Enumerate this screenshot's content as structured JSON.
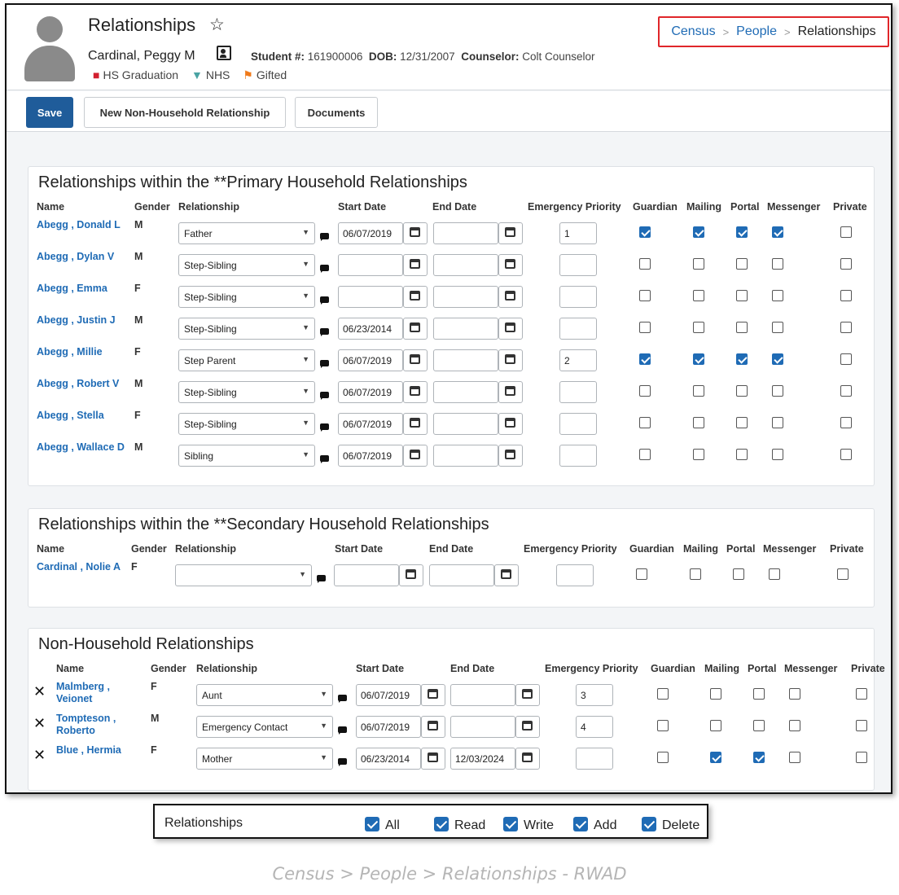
{
  "header": {
    "title": "Relationships",
    "student_name": "Cardinal, Peggy M",
    "student_num_label": "Student #:",
    "student_num": "161900006",
    "dob_label": "DOB:",
    "dob": "12/31/2007",
    "counselor_label": "Counselor:",
    "counselor": "Colt Counselor",
    "flags": [
      "HS Graduation",
      "NHS",
      "Gifted"
    ]
  },
  "breadcrumb": [
    "Census",
    "People",
    "Relationships"
  ],
  "toolbar": {
    "save": "Save",
    "new_nonhousehold": "New Non-Household Relationship",
    "documents": "Documents"
  },
  "columns": [
    "Name",
    "Gender",
    "Relationship",
    "Start Date",
    "End Date",
    "Emergency Priority",
    "Guardian",
    "Mailing",
    "Portal",
    "Messenger",
    "Private"
  ],
  "primary": {
    "title": "Relationships within the **Primary Household Relationships",
    "rows": [
      {
        "name": "Abegg , Donald L",
        "gender": "M",
        "relationship": "Father",
        "start": "06/07/2019",
        "end": "",
        "priority": "1",
        "guardian": true,
        "mailing": true,
        "portal": true,
        "messenger": true,
        "private": false
      },
      {
        "name": "Abegg , Dylan V",
        "gender": "M",
        "relationship": "Step-Sibling",
        "start": "",
        "end": "",
        "priority": "",
        "guardian": false,
        "mailing": false,
        "portal": false,
        "messenger": false,
        "private": false
      },
      {
        "name": "Abegg , Emma",
        "gender": "F",
        "relationship": "Step-Sibling",
        "start": "",
        "end": "",
        "priority": "",
        "guardian": false,
        "mailing": false,
        "portal": false,
        "messenger": false,
        "private": false
      },
      {
        "name": "Abegg , Justin J",
        "gender": "M",
        "relationship": "Step-Sibling",
        "start": "06/23/2014",
        "end": "",
        "priority": "",
        "guardian": false,
        "mailing": false,
        "portal": false,
        "messenger": false,
        "private": false
      },
      {
        "name": "Abegg , Millie",
        "gender": "F",
        "relationship": "Step Parent",
        "start": "06/07/2019",
        "end": "",
        "priority": "2",
        "guardian": true,
        "mailing": true,
        "portal": true,
        "messenger": true,
        "private": false
      },
      {
        "name": "Abegg , Robert V",
        "gender": "M",
        "relationship": "Step-Sibling",
        "start": "06/07/2019",
        "end": "",
        "priority": "",
        "guardian": false,
        "mailing": false,
        "portal": false,
        "messenger": false,
        "private": false
      },
      {
        "name": "Abegg , Stella",
        "gender": "F",
        "relationship": "Step-Sibling",
        "start": "06/07/2019",
        "end": "",
        "priority": "",
        "guardian": false,
        "mailing": false,
        "portal": false,
        "messenger": false,
        "private": false
      },
      {
        "name": "Abegg , Wallace D",
        "gender": "M",
        "relationship": "Sibling",
        "start": "06/07/2019",
        "end": "",
        "priority": "",
        "guardian": false,
        "mailing": false,
        "portal": false,
        "messenger": false,
        "private": false
      }
    ]
  },
  "secondary": {
    "title": "Relationships within the **Secondary Household Relationships",
    "rows": [
      {
        "name": "Cardinal , Nolie A",
        "gender": "F",
        "relationship": "",
        "start": "",
        "end": "",
        "priority": "",
        "guardian": false,
        "mailing": false,
        "portal": false,
        "messenger": false,
        "private": false
      }
    ]
  },
  "nonhousehold": {
    "title": "Non-Household Relationships",
    "rows": [
      {
        "name": "Malmberg , Veionet",
        "gender": "F",
        "relationship": "Aunt",
        "start": "06/07/2019",
        "end": "",
        "priority": "3",
        "guardian": false,
        "mailing": false,
        "portal": false,
        "messenger": false,
        "private": false
      },
      {
        "name": "Tompteson , Roberto",
        "gender": "M",
        "relationship": "Emergency Contact",
        "start": "06/07/2019",
        "end": "",
        "priority": "4",
        "guardian": false,
        "mailing": false,
        "portal": false,
        "messenger": false,
        "private": false
      },
      {
        "name": "Blue , Hermia",
        "gender": "F",
        "relationship": "Mother",
        "start": "06/23/2014",
        "end": "12/03/2024",
        "priority": "",
        "guardian": false,
        "mailing": true,
        "portal": true,
        "messenger": false,
        "private": false
      }
    ]
  },
  "permissions": {
    "label": "Relationships",
    "items": [
      "All",
      "Read",
      "Write",
      "Add",
      "Delete"
    ]
  },
  "caption": "Census > People > Relationships - RWAD"
}
